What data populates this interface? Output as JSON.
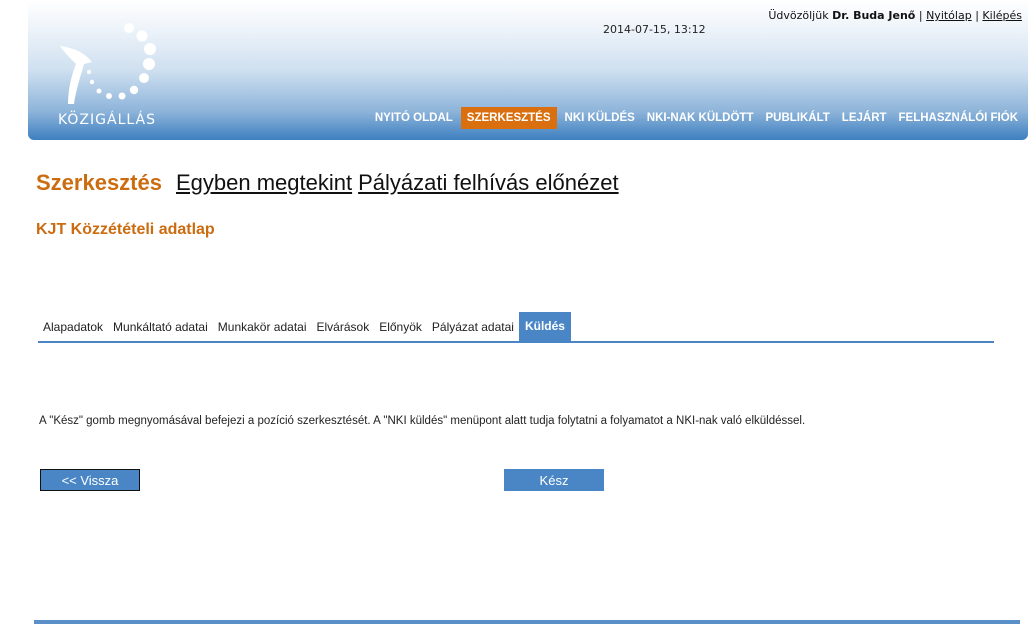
{
  "header": {
    "logo_text": "KÖZIGÁLLÁS",
    "datetime": "2014-07-15, 13:12",
    "welcome_prefix": "Üdvözöljük",
    "user_name": "Dr. Buda Jenő",
    "sep1": "|",
    "home_link": "Nyitólap",
    "sep2": "|",
    "logout_link": "Kilépés"
  },
  "nav": {
    "items": [
      {
        "label": "NYITÓ OLDAL"
      },
      {
        "label": "SZERKESZTÉS"
      },
      {
        "label": "NKI KÜLDÉS"
      },
      {
        "label": "NKI-NAK KÜLDÖTT"
      },
      {
        "label": "PUBLIKÁLT"
      },
      {
        "label": "LEJÁRT"
      },
      {
        "label": "FELHASZNÁLÓI FIÓK"
      }
    ],
    "active": "SZERKESZTÉS"
  },
  "title": {
    "main": "Szerkesztés",
    "link1": "Egyben megtekint",
    "link2": "Pályázati felhívás előnézet"
  },
  "subtitle": "KJT Közzétételi adatlap",
  "tabs": {
    "items": [
      {
        "label": "Alapadatok"
      },
      {
        "label": "Munkáltató adatai"
      },
      {
        "label": "Munkakör adatai"
      },
      {
        "label": "Elvárások"
      },
      {
        "label": "Előnyök"
      },
      {
        "label": "Pályázat adatai"
      },
      {
        "label": "Küldés"
      }
    ],
    "active": "Küldés"
  },
  "info_text": "A \"Kész\" gomb megnyomásával befejezi a pozíció szerkesztését. A \"NKI küldés\" menüpont alatt tudja folytatni a folyamatot a NKI-nak való elküldéssel.",
  "buttons": {
    "back": "<< Vissza",
    "done": "Kész"
  },
  "colors": {
    "accent_orange": "#cc6c10",
    "nav_active": "#d96f0f",
    "blue": "#4a86c5"
  }
}
